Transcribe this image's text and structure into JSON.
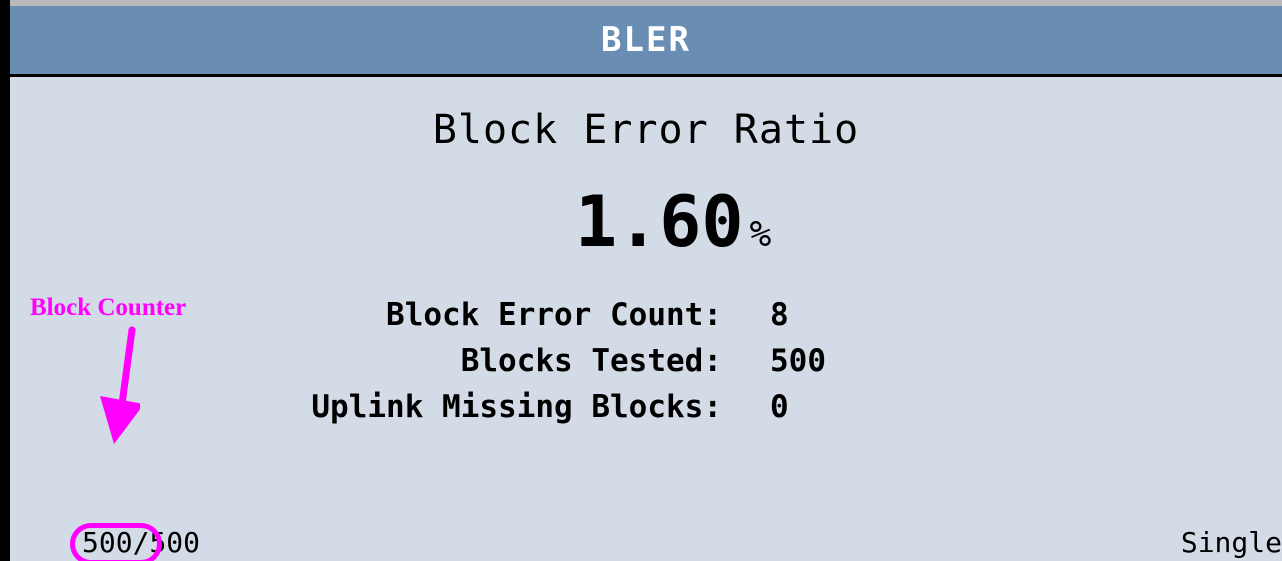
{
  "header": {
    "title": "BLER"
  },
  "main": {
    "heading": "Block Error Ratio",
    "ratio_value": "1.60",
    "ratio_unit": "%",
    "stats": [
      {
        "label": "Block Error Count:",
        "value": "8"
      },
      {
        "label": "Blocks Tested:",
        "value": "500"
      },
      {
        "label": "Uplink Missing Blocks:",
        "value": "0"
      }
    ]
  },
  "footer": {
    "counter_current": "500",
    "counter_separator": "/",
    "counter_total": "500",
    "mode": "Single"
  },
  "annotation": {
    "label": "Block Counter",
    "color": "#ff00ff"
  },
  "colors": {
    "title_bar": "#6a8db3",
    "panel": "#d3dbe6",
    "text": "#000000"
  }
}
